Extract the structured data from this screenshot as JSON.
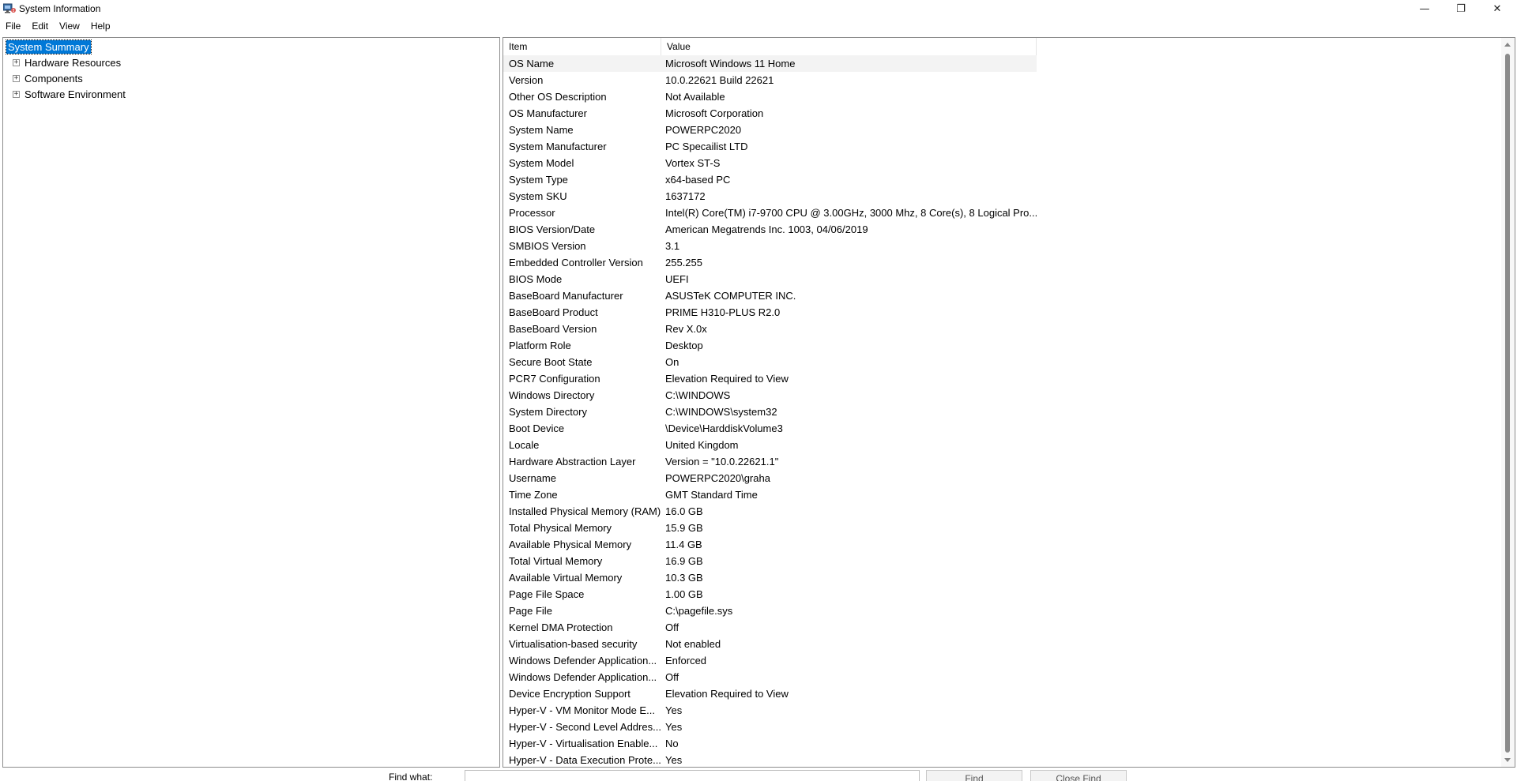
{
  "window": {
    "title": "System Information",
    "minimize": "—",
    "maximize": "❐",
    "close": "✕"
  },
  "menu": [
    "File",
    "Edit",
    "View",
    "Help"
  ],
  "tree": {
    "root": "System Summary",
    "children": [
      "Hardware Resources",
      "Components",
      "Software Environment"
    ]
  },
  "list": {
    "headers": {
      "item": "Item",
      "value": "Value"
    },
    "rows": [
      {
        "item": "OS Name",
        "value": "Microsoft Windows 11 Home"
      },
      {
        "item": "Version",
        "value": "10.0.22621 Build 22621"
      },
      {
        "item": "Other OS Description",
        "value": "Not Available"
      },
      {
        "item": "OS Manufacturer",
        "value": "Microsoft Corporation"
      },
      {
        "item": "System Name",
        "value": "POWERPC2020"
      },
      {
        "item": "System Manufacturer",
        "value": "PC Specailist LTD"
      },
      {
        "item": "System Model",
        "value": "Vortex ST-S"
      },
      {
        "item": "System Type",
        "value": "x64-based PC"
      },
      {
        "item": "System SKU",
        "value": "1637172"
      },
      {
        "item": "Processor",
        "value": "Intel(R) Core(TM) i7-9700 CPU @ 3.00GHz, 3000 Mhz, 8 Core(s), 8 Logical Pro..."
      },
      {
        "item": "BIOS Version/Date",
        "value": "American Megatrends Inc. 1003, 04/06/2019"
      },
      {
        "item": "SMBIOS Version",
        "value": "3.1"
      },
      {
        "item": "Embedded Controller Version",
        "value": "255.255"
      },
      {
        "item": "BIOS Mode",
        "value": "UEFI"
      },
      {
        "item": "BaseBoard Manufacturer",
        "value": "ASUSTeK COMPUTER INC."
      },
      {
        "item": "BaseBoard Product",
        "value": "PRIME H310-PLUS R2.0"
      },
      {
        "item": "BaseBoard Version",
        "value": "Rev X.0x"
      },
      {
        "item": "Platform Role",
        "value": "Desktop"
      },
      {
        "item": "Secure Boot State",
        "value": "On"
      },
      {
        "item": "PCR7 Configuration",
        "value": "Elevation Required to View"
      },
      {
        "item": "Windows Directory",
        "value": "C:\\WINDOWS"
      },
      {
        "item": "System Directory",
        "value": "C:\\WINDOWS\\system32"
      },
      {
        "item": "Boot Device",
        "value": "\\Device\\HarddiskVolume3"
      },
      {
        "item": "Locale",
        "value": "United Kingdom"
      },
      {
        "item": "Hardware Abstraction Layer",
        "value": "Version = \"10.0.22621.1\""
      },
      {
        "item": "Username",
        "value": "POWERPC2020\\graha"
      },
      {
        "item": "Time Zone",
        "value": "GMT Standard Time"
      },
      {
        "item": "Installed Physical Memory (RAM)",
        "value": "16.0 GB"
      },
      {
        "item": "Total Physical Memory",
        "value": "15.9 GB"
      },
      {
        "item": "Available Physical Memory",
        "value": "11.4 GB"
      },
      {
        "item": "Total Virtual Memory",
        "value": "16.9 GB"
      },
      {
        "item": "Available Virtual Memory",
        "value": "10.3 GB"
      },
      {
        "item": "Page File Space",
        "value": "1.00 GB"
      },
      {
        "item": "Page File",
        "value": "C:\\pagefile.sys"
      },
      {
        "item": "Kernel DMA Protection",
        "value": "Off"
      },
      {
        "item": "Virtualisation-based security",
        "value": "Not enabled"
      },
      {
        "item": "Windows Defender Application...",
        "value": "Enforced"
      },
      {
        "item": "Windows Defender Application...",
        "value": "Off"
      },
      {
        "item": "Device Encryption Support",
        "value": "Elevation Required to View"
      },
      {
        "item": "Hyper-V - VM Monitor Mode E...",
        "value": "Yes"
      },
      {
        "item": "Hyper-V - Second Level Addres...",
        "value": "Yes"
      },
      {
        "item": "Hyper-V - Virtualisation Enable...",
        "value": "No"
      },
      {
        "item": "Hyper-V - Data Execution Prote...",
        "value": "Yes"
      }
    ]
  },
  "find": {
    "label": "Find what:",
    "value": "",
    "find_button": "Find",
    "close_button": "Close Find"
  }
}
